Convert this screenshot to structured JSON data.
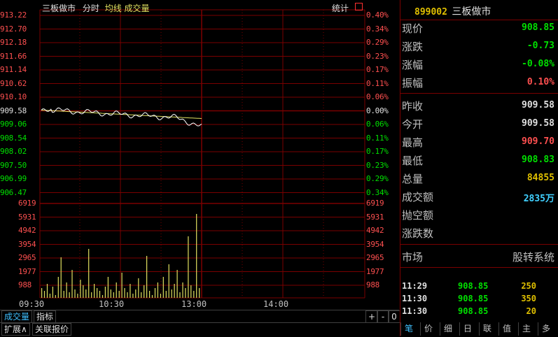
{
  "header": {
    "title": "三板做市",
    "mode": "分时",
    "avg_line": "均线",
    "volume": "成交量",
    "stats": "统计"
  },
  "price_axis": {
    "left_labels": [
      "913.22",
      "912.70",
      "912.18",
      "911.66",
      "911.14",
      "910.62",
      "910.10",
      "909.58",
      "909.06",
      "908.54",
      "908.02",
      "907.50",
      "906.99",
      "906.47"
    ],
    "right_labels": [
      "0.40%",
      "0.34%",
      "0.29%",
      "0.23%",
      "0.17%",
      "0.11%",
      "0.06%",
      "0.00%",
      "0.06%",
      "0.11%",
      "0.17%",
      "0.23%",
      "0.29%",
      "0.34%"
    ]
  },
  "volume_axis": {
    "labels": [
      "6919",
      "5931",
      "4942",
      "3954",
      "2965",
      "1977",
      "988"
    ]
  },
  "time_axis": [
    "09:30",
    "10:30",
    "13:00",
    "14:00"
  ],
  "bottom": {
    "tab_volume": "成交量",
    "tab_indicator": "指标",
    "plus": "+",
    "minus": "-",
    "zero": "0",
    "expand": "扩展∧",
    "related": "关联报价"
  },
  "quote": {
    "code": "899002",
    "name": "三板做市",
    "rows1": [
      {
        "label": "现价",
        "value": "908.85",
        "color": "#00e000"
      },
      {
        "label": "涨跌",
        "value": "-0.73",
        "color": "#00e000"
      },
      {
        "label": "涨幅",
        "value": "-0.08%",
        "color": "#00e000"
      },
      {
        "label": "振幅",
        "value": "0.10%",
        "color": "#ff5050"
      }
    ],
    "rows2": [
      {
        "label": "昨收",
        "value": "909.58",
        "color": "#e0e0e0"
      },
      {
        "label": "今开",
        "value": "909.58",
        "color": "#e0e0e0"
      },
      {
        "label": "最高",
        "value": "909.70",
        "color": "#ff5050"
      },
      {
        "label": "最低",
        "value": "908.83",
        "color": "#00e000"
      },
      {
        "label": "总量",
        "value": "84855",
        "color": "#e0c000"
      },
      {
        "label": "成交额",
        "value": "2835万",
        "color": "#40d0ff"
      },
      {
        "label": "抛空额",
        "value": "",
        "color": "#e0e0e0"
      },
      {
        "label": "涨跌数",
        "value": "",
        "color": "#e0e0e0"
      }
    ],
    "market_label": "市场",
    "market_value": "股转系统",
    "ticks": [
      {
        "time": "11:29",
        "price": "908.85",
        "vol": "250"
      },
      {
        "time": "11:30",
        "price": "908.85",
        "vol": "350"
      },
      {
        "time": "11:30",
        "price": "908.85",
        "vol": "20"
      }
    ],
    "tabs": [
      "笔",
      "价",
      "细",
      "日",
      "联",
      "值",
      "主",
      "多"
    ]
  },
  "colors": {
    "grid": "#7a0000",
    "up": "#ff5050",
    "down": "#00e000",
    "price_line": "#ffffff",
    "avg_line": "#e0e060",
    "volume_bar": "#e0e060"
  }
}
